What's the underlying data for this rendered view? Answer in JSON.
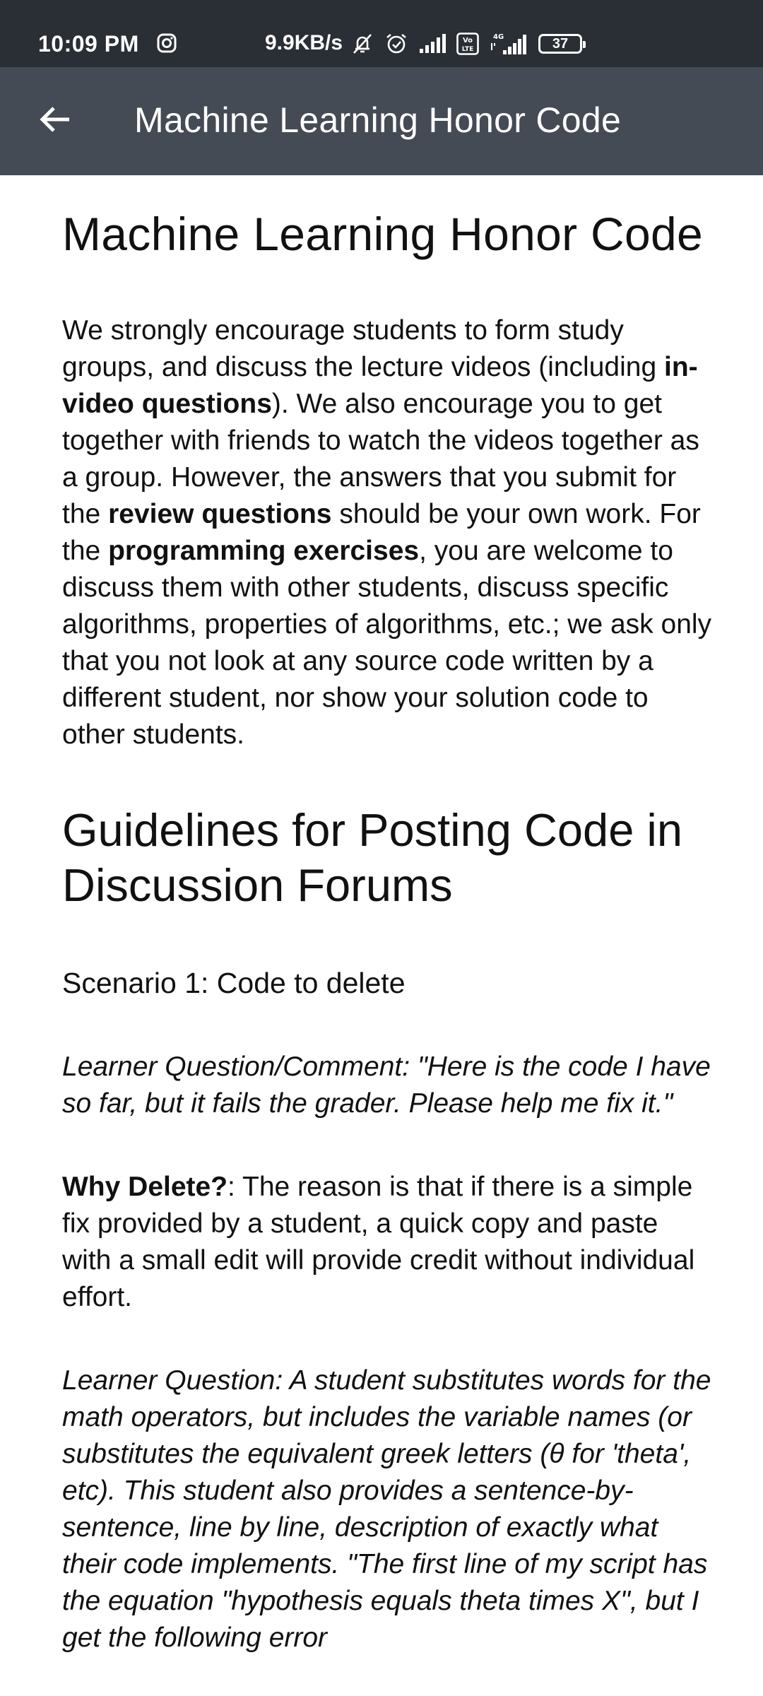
{
  "status_bar": {
    "time": "10:09 PM",
    "network_speed": "9.9KB/s",
    "network_4g": "4G",
    "volte": "Vo LTE",
    "battery": "37",
    "icons": [
      "instagram-icon",
      "mute-icon",
      "alarm-icon",
      "signal-icon",
      "volte-icon",
      "signal-4g-icon",
      "battery-icon"
    ]
  },
  "app_bar": {
    "title": "Machine Learning Honor Code",
    "back_icon": "arrow-left-icon"
  },
  "article": {
    "heading": "Machine Learning Honor Code",
    "intro": {
      "t1": "We strongly encourage students to form study groups, and discuss the lecture videos (including ",
      "b1": "in-video questions",
      "t2": "). We also encourage you to get together with friends to watch the videos together as a group. However, the answers that you submit for the ",
      "b2": "review questions",
      "t3": " should be your own work. For the ",
      "b3": "programming exercises",
      "t4": ", you are welcome to discuss them with other students, discuss specific algorithms, properties of algorithms, etc.; we ask only that you not look at any source code written by a different student, nor show your solution code to other students."
    },
    "guidelines_heading": "Guidelines for Posting Code in Discussion Forums",
    "scenario_1": "Scenario 1: Code to delete",
    "learner_q1": "Learner Question/Comment: \"Here is the code I have so far, but it fails the grader. Please help me fix it.\"",
    "why_delete": {
      "label": "Why Delete?",
      "text": ": The reason is that if there is a simple fix provided by a student, a quick copy and paste with a small edit will provide credit without individual effort."
    },
    "learner_q2": "Learner Question: A student substitutes words for the math operators, but includes the variable names (or substitutes the equivalent greek letters (θ for 'theta', etc). This student also provides a sentence-by-sentence, line by line, description of exactly what their code implements. \"The first line of my script has the equation \"hypothesis equals theta times X\", but I get the following error"
  },
  "colors": {
    "status_bar": "#2a2e35",
    "app_bar": "#454b54",
    "background": "#ffffff",
    "text": "#111111"
  }
}
